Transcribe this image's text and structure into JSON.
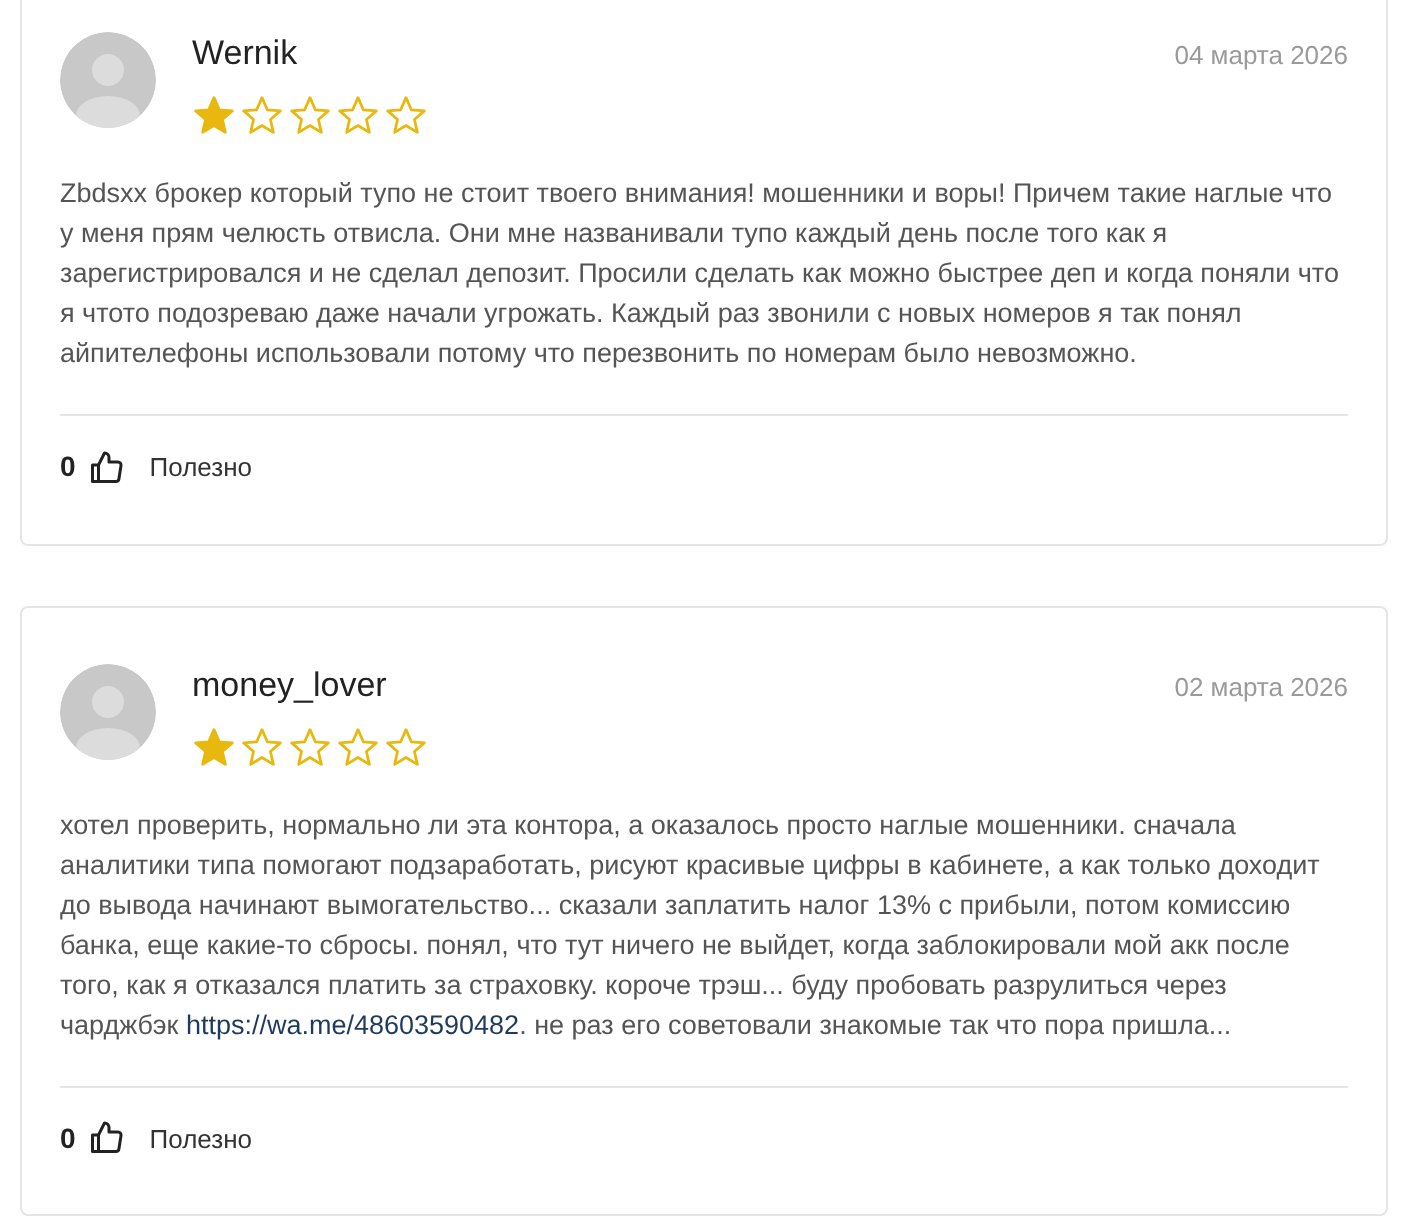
{
  "reviews": [
    {
      "author": "Wernik",
      "date": "04 марта 2026",
      "stars": 1,
      "body": [
        "Zbdsxx брокер который тупо не стоит твоего внимания! мошенники и воры! Причем такие наглые что у меня прям челюсть отвисла. Они мне названивали тупо каждый день после того как я зарегистрировался и не сделал депозит. Просили сделать как можно быстрее деп и когда поняли что я чтото подозреваю даже начали угрожать. Каждый раз звонили с новых номеров я так понял айпителефоны использовали потому что перезвонить по номерам было невозможно."
      ],
      "likes": "0",
      "helpful": "Полезно"
    },
    {
      "author": "money_lover",
      "date": "02 марта 2026",
      "stars": 1,
      "body": [
        "хотел проверить, нормально ли эта контора, а оказалось просто наглые мошенники. сначала аналитики типа помогают подзаработать, рисуют красивые цифры в кабинете, а как только доходит до вывода начинают вымогательство... сказали заплатить налог 13% с прибыли, потом комиссию банка, еще какие-то сбросы. понял, что тут ничего не выйдет, когда заблокировали мой акк после того, как я отказался платить за страховку. короче трэш... буду пробовать разрулиться через чарджбэк ",
        {
          "link": "https://wa.me/48603590482"
        },
        ". не раз его советовали знакомые так что пора пришла..."
      ],
      "likes": "0",
      "helpful": "Полезно"
    }
  ]
}
